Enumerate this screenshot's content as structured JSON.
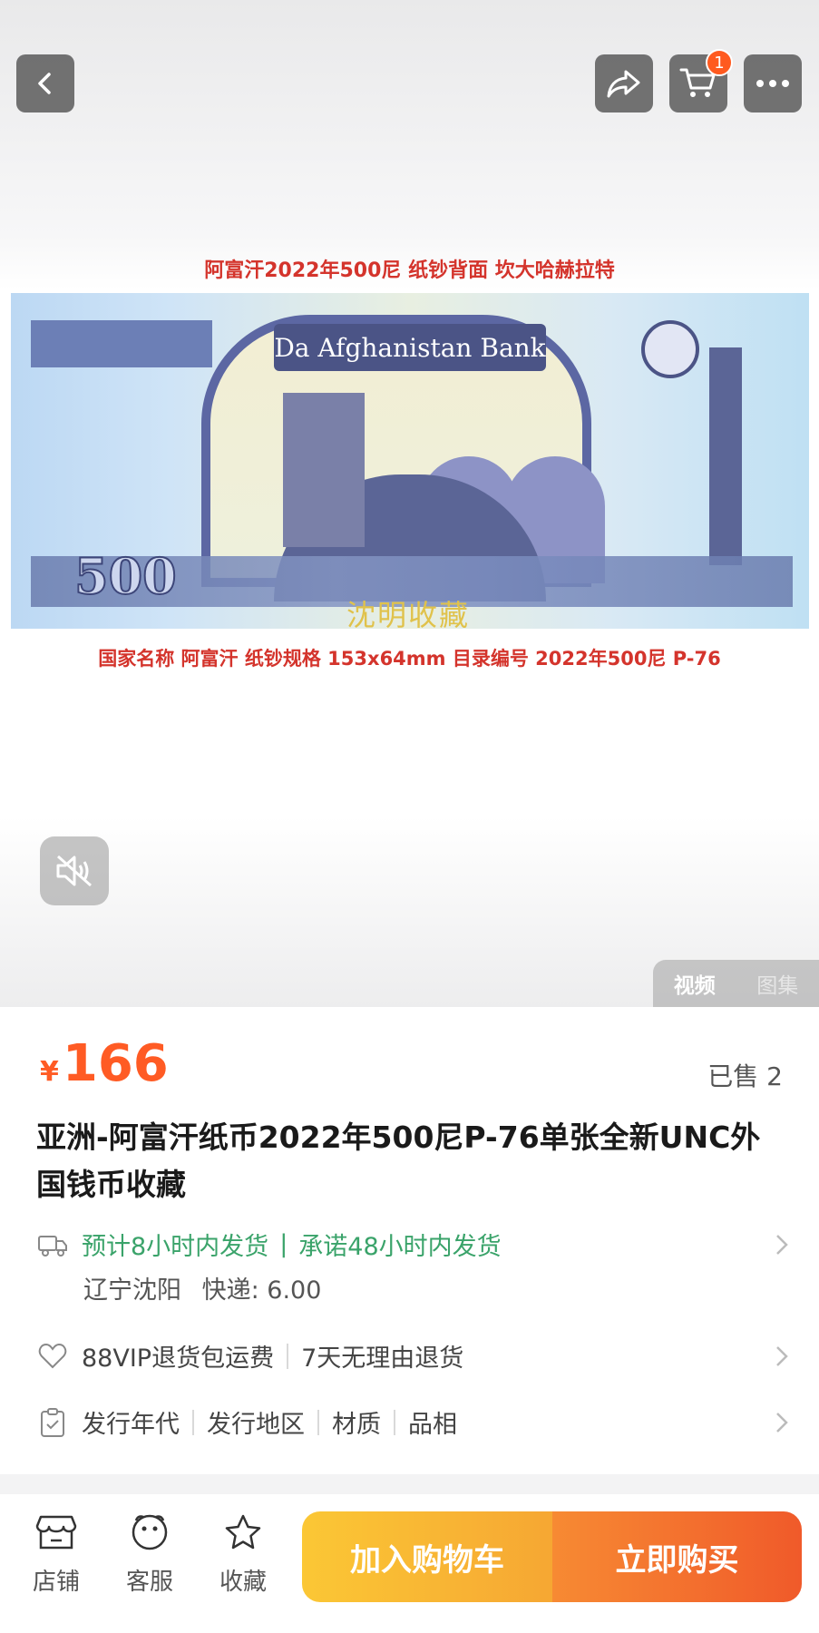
{
  "header": {
    "cart_count": "1"
  },
  "media": {
    "caption_top": "阿富汗2022年500尼 纸钞背面 坎大哈赫拉特",
    "caption_bottom": "国家名称 阿富汗 纸钞规格 153x64mm 目录编号 2022年500尼 P-76",
    "banknote": {
      "bank_name": "Da Afghanistan Bank",
      "denomination": "500",
      "watermark": "沈明收藏"
    },
    "tabs": [
      "视频",
      "图集"
    ]
  },
  "product": {
    "price_symbol": "¥",
    "price": "166",
    "sold": "已售 2",
    "title": "亚洲-阿富汗纸币2022年500尼P-76单张全新UNC外国钱币收藏"
  },
  "shipping": {
    "estimate": "预计8小时内发货",
    "promise": "承诺48小时内发货",
    "origin": "辽宁沈阳",
    "express": "快递: 6.00"
  },
  "returns": {
    "vip": "88VIP退货包运费",
    "no_reason": "7天无理由退货"
  },
  "attributes": [
    "发行年代",
    "发行地区",
    "材质",
    "品相"
  ],
  "bottom_bar": {
    "store": "店铺",
    "service": "客服",
    "favorite": "收藏",
    "add_to_cart": "加入购物车",
    "buy_now": "立即购买"
  },
  "colors": {
    "price": "#ff5b24",
    "shipping_text": "#3aa36a",
    "cart_button": "#fbc735",
    "buy_button": "#f05a2a"
  },
  "icons": [
    "back-icon",
    "share-icon",
    "cart-icon",
    "more-icon",
    "mute-icon",
    "truck-icon",
    "heart-icon",
    "clipboard-icon",
    "store-icon",
    "service-icon",
    "star-icon",
    "chevron-right-icon"
  ]
}
